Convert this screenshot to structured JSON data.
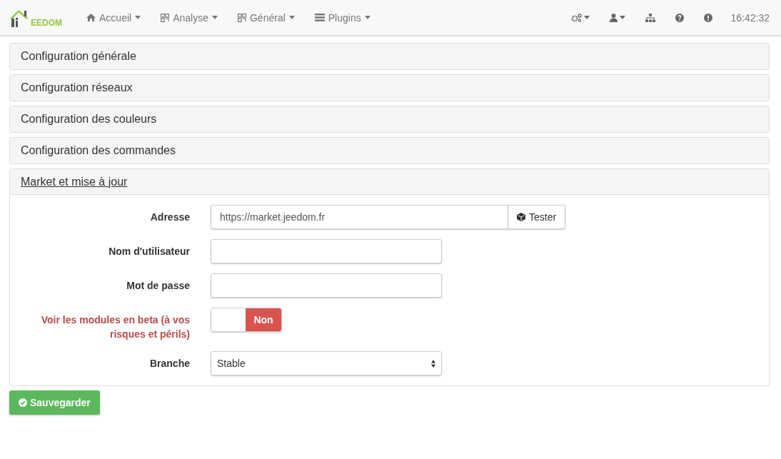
{
  "navbar": {
    "logo_text": "EEDOM",
    "menus": [
      {
        "label": "Accueil"
      },
      {
        "label": "Analyse"
      },
      {
        "label": "Général"
      },
      {
        "label": "Plugins"
      }
    ],
    "time": "16:42:32"
  },
  "panels": [
    {
      "title": "Configuration générale",
      "expanded": false
    },
    {
      "title": "Configuration réseaux",
      "expanded": false
    },
    {
      "title": "Configuration des couleurs",
      "expanded": false
    },
    {
      "title": "Configuration des commandes",
      "expanded": false
    },
    {
      "title": "Market et mise à jour",
      "expanded": true
    }
  ],
  "form": [
    {
      "kind": "input-button",
      "label": "Adresse",
      "warning": false,
      "value": "https://market.jeedom.fr",
      "button": "Tester"
    },
    {
      "kind": "input",
      "label": "Nom d'utilisateur",
      "warning": false
    },
    {
      "kind": "input",
      "label": "Mot de passe",
      "warning": false
    },
    {
      "kind": "toggle",
      "label": "Voir les modules en beta (à vos risques et périls)",
      "warning": true,
      "on": false,
      "state_label": "Non"
    },
    {
      "kind": "select",
      "label": "Branche",
      "warning": false,
      "value": "Stable"
    }
  ],
  "save_button": "Sauvegarder"
}
